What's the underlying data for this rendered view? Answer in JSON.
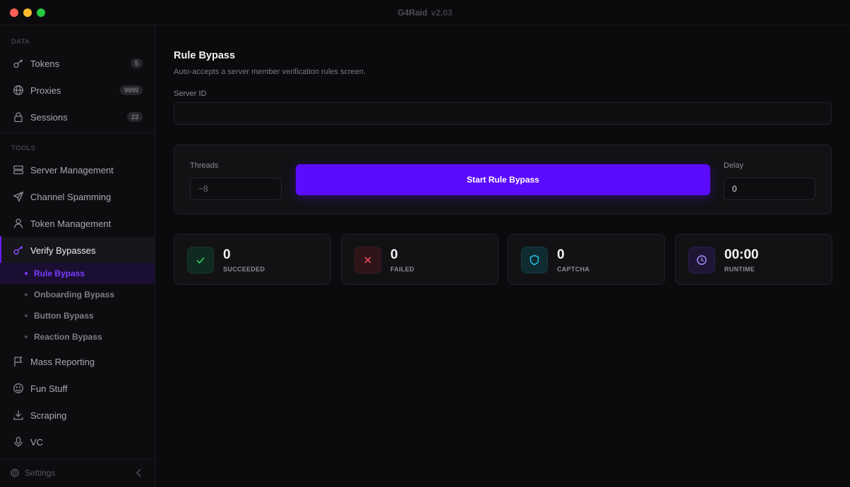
{
  "window": {
    "title": "G4Raid",
    "version": "v2.03"
  },
  "sidebar": {
    "sections": {
      "data": "DATA",
      "tools": "TOOLS"
    },
    "data_items": [
      {
        "label": "Tokens",
        "badge": "5",
        "icon": "key-icon"
      },
      {
        "label": "Proxies",
        "badge": "9999",
        "icon": "globe-icon"
      },
      {
        "label": "Sessions",
        "badge": "23",
        "icon": "lock-icon"
      }
    ],
    "tool_items": [
      {
        "label": "Server Management",
        "icon": "server-icon"
      },
      {
        "label": "Channel Spamming",
        "icon": "send-icon"
      },
      {
        "label": "Token Management",
        "icon": "user-icon"
      },
      {
        "label": "Verify Bypasses",
        "icon": "key-icon",
        "active": true
      },
      {
        "label": "Mass Reporting",
        "icon": "flag-icon"
      },
      {
        "label": "Fun Stuff",
        "icon": "smile-icon"
      },
      {
        "label": "Scraping",
        "icon": "download-icon"
      },
      {
        "label": "VC",
        "icon": "mic-icon"
      }
    ],
    "sub_items": [
      {
        "label": "Rule Bypass",
        "active": true
      },
      {
        "label": "Onboarding Bypass"
      },
      {
        "label": "Button Bypass"
      },
      {
        "label": "Reaction Bypass"
      }
    ],
    "settings_label": "Settings"
  },
  "main": {
    "title": "Rule Bypass",
    "description": "Auto-accepts a server member verification rules screen.",
    "server_id_label": "Server ID",
    "server_id_value": "",
    "threads_label": "Threads",
    "threads_placeholder": "~8",
    "start_button": "Start Rule Bypass",
    "delay_label": "Delay",
    "delay_value": "0"
  },
  "stats": [
    {
      "value": "0",
      "label": "SUCCEEDED",
      "icon": "check-icon",
      "color": "#2fd46b"
    },
    {
      "value": "0",
      "label": "FAILED",
      "icon": "x-icon",
      "color": "#ff4d5e"
    },
    {
      "value": "0",
      "label": "CAPTCHA",
      "icon": "shield-icon",
      "color": "#22c3e6"
    },
    {
      "value": "00:00",
      "label": "RUNTIME",
      "icon": "clock-icon",
      "color": "#a98bff"
    }
  ],
  "colors": {
    "accent": "#5b0cff",
    "accent_text": "#7c3cff"
  }
}
